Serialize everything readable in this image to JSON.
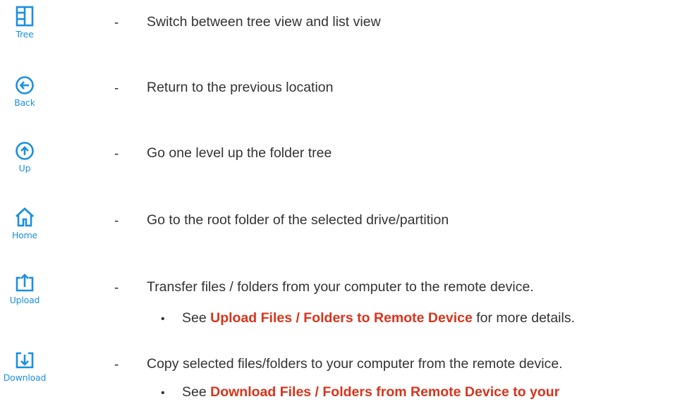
{
  "items": [
    {
      "icon": "tree-view-icon",
      "label": "Tree",
      "description": "Switch between tree view and list view"
    },
    {
      "icon": "back-arrow-icon",
      "label": "Back",
      "description": "Return to the previous location"
    },
    {
      "icon": "up-arrow-icon",
      "label": "Up",
      "description": "Go one level up the folder tree"
    },
    {
      "icon": "home-icon",
      "label": "Home",
      "description": "Go to the root folder of the selected drive/partition"
    },
    {
      "icon": "upload-icon",
      "label": "Upload",
      "description": "Transfer files / folders from your computer to the remote device.",
      "sub": {
        "prefix": "See ",
        "link": "Upload Files / Folders to Remote Device",
        "suffix": " for more details."
      }
    },
    {
      "icon": "download-icon",
      "label": "Download",
      "description": "Copy selected files/folders to your computer from the remote device.",
      "sub": {
        "prefix": "See ",
        "link": "Download Files / Folders from Remote Device to your",
        "suffix": ""
      }
    }
  ],
  "dash": "-",
  "bullet": "•",
  "colors": {
    "icon": "#1a8fe0",
    "link": "#d9341c",
    "text": "#333333"
  }
}
